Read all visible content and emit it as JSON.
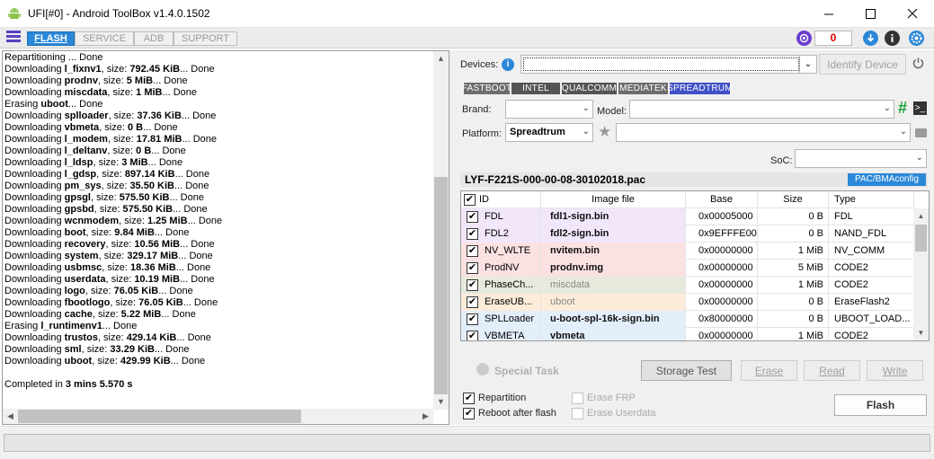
{
  "window": {
    "title": "UFI[#0] - Android ToolBox v1.4.0.1502"
  },
  "toolbar": {
    "tabs": [
      "FLASH",
      "SERVICE",
      "ADB",
      "SUPPORT"
    ],
    "counter": "0"
  },
  "log": {
    "lines": [
      {
        "pre": "Repartitioning ... Done",
        "bold": "",
        "post": ""
      },
      {
        "pre": "Downloading ",
        "bold": "l_fixnv1",
        "post": ", size: ",
        "bold2": "792.45 KiB",
        "post2": "... Done"
      },
      {
        "pre": "Downloading ",
        "bold": "prodnv",
        "post": ", size: ",
        "bold2": "5 MiB",
        "post2": "... Done"
      },
      {
        "pre": "Downloading ",
        "bold": "miscdata",
        "post": ", size: ",
        "bold2": "1 MiB",
        "post2": "... Done"
      },
      {
        "pre": "Erasing ",
        "bold": "uboot",
        "post": "... Done",
        "bold2": "",
        "post2": ""
      },
      {
        "pre": "Downloading ",
        "bold": "splloader",
        "post": ", size: ",
        "bold2": "37.36 KiB",
        "post2": "... Done"
      },
      {
        "pre": "Downloading ",
        "bold": "vbmeta",
        "post": ", size: ",
        "bold2": "0 B",
        "post2": "... Done"
      },
      {
        "pre": "Downloading ",
        "bold": "l_modem",
        "post": ", size: ",
        "bold2": "17.81 MiB",
        "post2": "... Done"
      },
      {
        "pre": "Downloading ",
        "bold": "l_deltanv",
        "post": ", size: ",
        "bold2": "0 B",
        "post2": "... Done"
      },
      {
        "pre": "Downloading ",
        "bold": "l_ldsp",
        "post": ", size: ",
        "bold2": "3 MiB",
        "post2": "... Done"
      },
      {
        "pre": "Downloading ",
        "bold": "l_gdsp",
        "post": ", size: ",
        "bold2": "897.14 KiB",
        "post2": "... Done"
      },
      {
        "pre": "Downloading ",
        "bold": "pm_sys",
        "post": ", size: ",
        "bold2": "35.50 KiB",
        "post2": "... Done"
      },
      {
        "pre": "Downloading ",
        "bold": "gpsgl",
        "post": ", size: ",
        "bold2": "575.50 KiB",
        "post2": "... Done"
      },
      {
        "pre": "Downloading ",
        "bold": "gpsbd",
        "post": ", size: ",
        "bold2": "575.50 KiB",
        "post2": "... Done"
      },
      {
        "pre": "Downloading ",
        "bold": "wcnmodem",
        "post": ", size: ",
        "bold2": "1.25 MiB",
        "post2": "... Done"
      },
      {
        "pre": "Downloading ",
        "bold": "boot",
        "post": ", size: ",
        "bold2": "9.84 MiB",
        "post2": "... Done"
      },
      {
        "pre": "Downloading ",
        "bold": "recovery",
        "post": ", size: ",
        "bold2": "10.56 MiB",
        "post2": "... Done"
      },
      {
        "pre": "Downloading ",
        "bold": "system",
        "post": ", size: ",
        "bold2": "329.17 MiB",
        "post2": "... Done"
      },
      {
        "pre": "Downloading ",
        "bold": "usbmsc",
        "post": ", size: ",
        "bold2": "18.36 MiB",
        "post2": "... Done"
      },
      {
        "pre": "Downloading ",
        "bold": "userdata",
        "post": ", size: ",
        "bold2": "10.19 MiB",
        "post2": "... Done"
      },
      {
        "pre": "Downloading ",
        "bold": "logo",
        "post": ", size: ",
        "bold2": "76.05 KiB",
        "post2": "... Done"
      },
      {
        "pre": "Downloading ",
        "bold": "fbootlogo",
        "post": ", size: ",
        "bold2": "76.05 KiB",
        "post2": "... Done"
      },
      {
        "pre": "Downloading ",
        "bold": "cache",
        "post": ", size: ",
        "bold2": "5.22 MiB",
        "post2": "... Done"
      },
      {
        "pre": "Erasing ",
        "bold": "l_runtimenv1",
        "post": "... Done",
        "bold2": "",
        "post2": ""
      },
      {
        "pre": "Downloading ",
        "bold": "trustos",
        "post": ", size: ",
        "bold2": "429.14 KiB",
        "post2": "... Done"
      },
      {
        "pre": "Downloading ",
        "bold": "sml",
        "post": ", size: ",
        "bold2": "33.29 KiB",
        "post2": "... Done"
      },
      {
        "pre": "Downloading ",
        "bold": "uboot",
        "post": ", size: ",
        "bold2": "429.99 KiB",
        "post2": "... Done"
      },
      {
        "pre": "",
        "bold": "",
        "post": "",
        "bold2": "",
        "post2": ""
      },
      {
        "pre": "Completed in ",
        "bold": "3 mins 5.570 s",
        "post": "",
        "bold2": "",
        "post2": ""
      }
    ]
  },
  "devices": {
    "label": "Devices:",
    "identify_label": "Identify Device"
  },
  "platform_tabs": [
    "FASTBOOT",
    "INTEL",
    "QUALCOMM",
    "MEDIATEK",
    "SPREADTRUM"
  ],
  "form": {
    "brand_label": "Brand:",
    "model_label": "Model:",
    "platform_label": "Platform:",
    "platform_value": "Spreadtrum",
    "soc_label": "SoC:"
  },
  "file": {
    "name": "LYF-F221S-000-00-08-30102018.pac",
    "config_label": "PAC/BMAconfig"
  },
  "grid": {
    "columns": [
      "ID",
      "Image file",
      "Base",
      "Size",
      "Type"
    ],
    "rows": [
      {
        "id": "FDL",
        "file": "fdl1-sign.bin",
        "base": "0x00005000",
        "size": "0 B",
        "type": "FDL",
        "bg": "#f1e6fa",
        "bold": true
      },
      {
        "id": "FDL2",
        "file": "fdl2-sign.bin",
        "base": "0x9EFFFE00",
        "size": "0 B",
        "type": "NAND_FDL",
        "bg": "#f1e6fa",
        "bold": true
      },
      {
        "id": "NV_WLTE",
        "file": "nvitem.bin",
        "base": "0x00000000",
        "size": "1 MiB",
        "type": "NV_COMM",
        "bg": "#fbe1e1",
        "bold": true
      },
      {
        "id": "ProdNV",
        "file": "prodnv.img",
        "base": "0x00000000",
        "size": "5 MiB",
        "type": "CODE2",
        "bg": "#fbe1e1",
        "bold": true
      },
      {
        "id": "PhaseCh...",
        "file": "miscdata",
        "base": "0x00000000",
        "size": "1 MiB",
        "type": "CODE2",
        "bg": "#e6eadd",
        "bold": false
      },
      {
        "id": "EraseUB...",
        "file": "uboot",
        "base": "0x00000000",
        "size": "0 B",
        "type": "EraseFlash2",
        "bg": "#fcecd9",
        "bold": false
      },
      {
        "id": "SPLLoader",
        "file": "u-boot-spl-16k-sign.bin",
        "base": "0x80000000",
        "size": "0 B",
        "type": "UBOOT_LOAD...",
        "bg": "#e3eefb",
        "bold": true
      },
      {
        "id": "VBMETA",
        "file": "vbmeta",
        "base": "0x00000000",
        "size": "1 MiB",
        "type": "CODE2",
        "bg": "#e3eefb",
        "bold": true
      }
    ]
  },
  "actions": {
    "special_task": "Special Task",
    "storage_test": "Storage Test",
    "erase": "Erase",
    "read": "Read",
    "write": "Write",
    "flash": "Flash"
  },
  "options": {
    "repartition": "Repartition",
    "reboot_after_flash": "Reboot after flash",
    "erase_frp": "Erase FRP",
    "erase_userdata": "Erase Userdata"
  },
  "colors": {
    "accent": "#2b88d8",
    "counter": "#dd0000",
    "spreadtrum_tab": "#3f51c5"
  }
}
